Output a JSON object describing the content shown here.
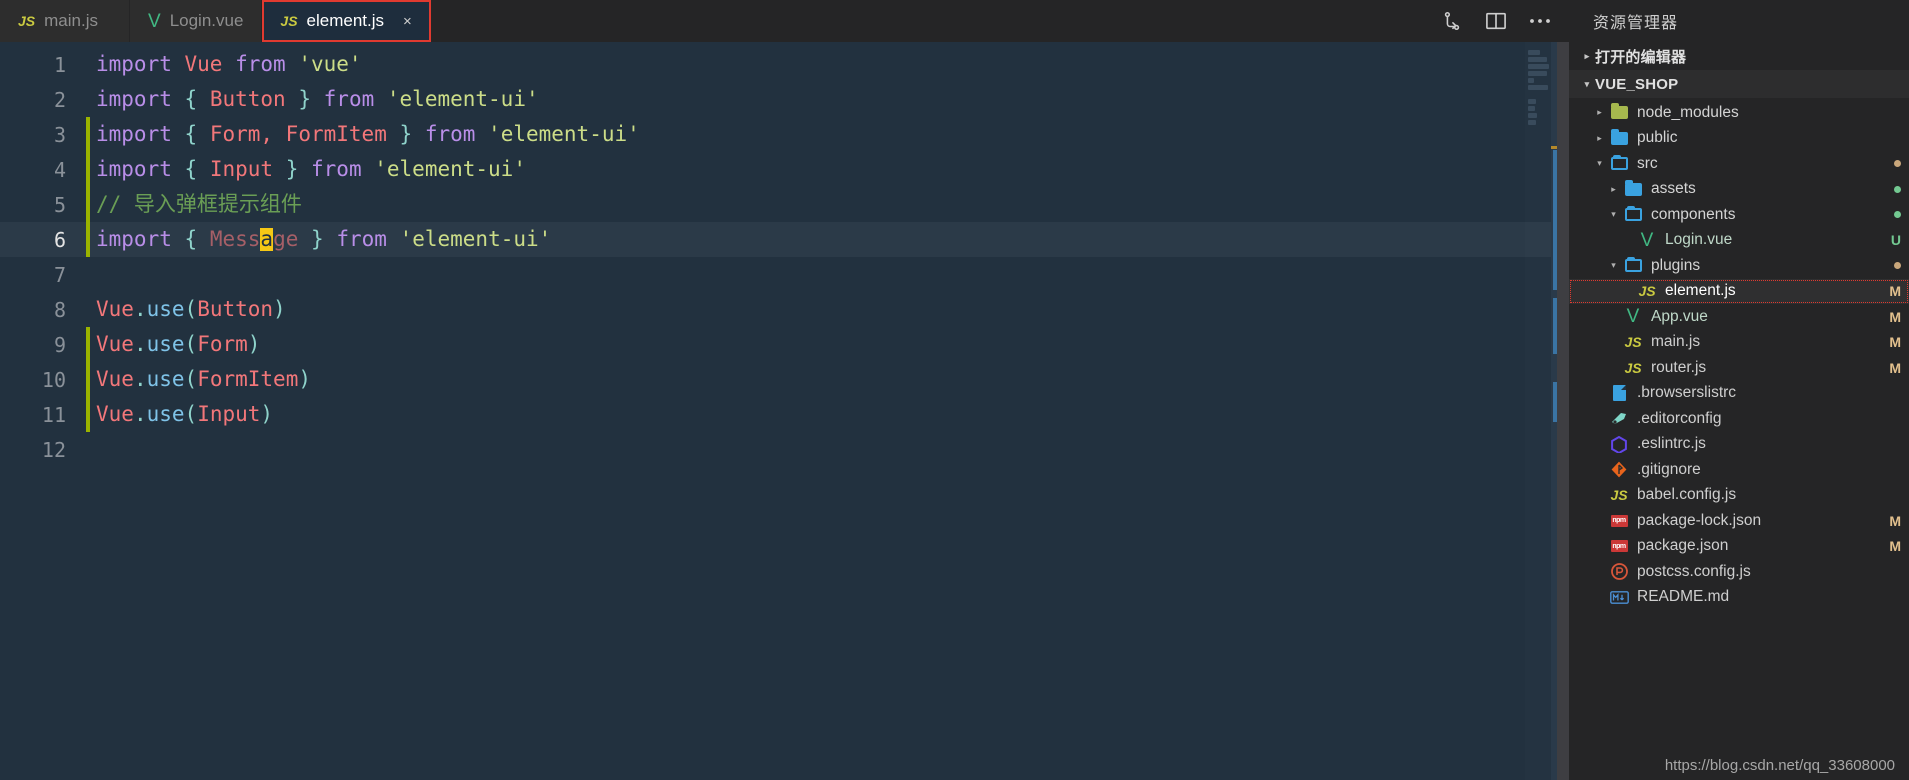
{
  "window": {
    "tabs": [
      {
        "icon": "js-file-icon",
        "label": "main.js",
        "active": false,
        "closable": false
      },
      {
        "icon": "vue-file-icon",
        "label": "Login.vue",
        "active": false,
        "closable": false
      },
      {
        "icon": "js-file-icon",
        "label": "element.js",
        "active": true,
        "closable": true,
        "close_label": "×",
        "highlighted": true
      }
    ],
    "actions": [
      {
        "name": "split-source-control-icon",
        "title": "Source Control"
      },
      {
        "name": "split-editor-icon",
        "title": "Split Editor"
      },
      {
        "name": "more-actions-icon",
        "title": "More Actions...",
        "glyph": "•••"
      }
    ],
    "sidebar_title": "资源管理器"
  },
  "editor": {
    "language": "javascript",
    "cursor_char": "a",
    "current_line": 6,
    "lines": [
      {
        "n": 1,
        "git": false,
        "current": false,
        "tokens": [
          {
            "t": "import",
            "c": "kw"
          },
          {
            "t": " ",
            "c": ""
          },
          {
            "t": "Vue",
            "c": "cls"
          },
          {
            "t": " ",
            "c": ""
          },
          {
            "t": "from",
            "c": "kw"
          },
          {
            "t": " ",
            "c": ""
          },
          {
            "t": "'vue'",
            "c": "str"
          }
        ]
      },
      {
        "n": 2,
        "git": false,
        "current": false,
        "tokens": [
          {
            "t": "import",
            "c": "kw"
          },
          {
            "t": " ",
            "c": ""
          },
          {
            "t": "{",
            "c": "pun"
          },
          {
            "t": " ",
            "c": ""
          },
          {
            "t": "Button",
            "c": "cls"
          },
          {
            "t": " ",
            "c": ""
          },
          {
            "t": "}",
            "c": "pun"
          },
          {
            "t": " ",
            "c": ""
          },
          {
            "t": "from",
            "c": "kw"
          },
          {
            "t": " ",
            "c": ""
          },
          {
            "t": "'element-ui'",
            "c": "str"
          }
        ]
      },
      {
        "n": 3,
        "git": true,
        "current": false,
        "tokens": [
          {
            "t": "import",
            "c": "kw"
          },
          {
            "t": " ",
            "c": ""
          },
          {
            "t": "{",
            "c": "pun"
          },
          {
            "t": " ",
            "c": ""
          },
          {
            "t": "Form, FormItem",
            "c": "cls"
          },
          {
            "t": " ",
            "c": ""
          },
          {
            "t": "}",
            "c": "pun"
          },
          {
            "t": " ",
            "c": ""
          },
          {
            "t": "from",
            "c": "kw"
          },
          {
            "t": " ",
            "c": ""
          },
          {
            "t": "'element-ui'",
            "c": "str"
          }
        ]
      },
      {
        "n": 4,
        "git": true,
        "current": false,
        "tokens": [
          {
            "t": "import",
            "c": "kw"
          },
          {
            "t": " ",
            "c": ""
          },
          {
            "t": "{",
            "c": "pun"
          },
          {
            "t": " ",
            "c": ""
          },
          {
            "t": "Input",
            "c": "cls"
          },
          {
            "t": " ",
            "c": ""
          },
          {
            "t": "}",
            "c": "pun"
          },
          {
            "t": " ",
            "c": ""
          },
          {
            "t": "from",
            "c": "kw"
          },
          {
            "t": " ",
            "c": ""
          },
          {
            "t": "'element-ui'",
            "c": "str"
          }
        ]
      },
      {
        "n": 5,
        "git": true,
        "current": false,
        "tokens": [
          {
            "t": "// 导入弹框提示组件",
            "c": "cm"
          }
        ]
      },
      {
        "n": 6,
        "git": true,
        "current": true,
        "tokens": [
          {
            "t": "import",
            "c": "kw"
          },
          {
            "t": " ",
            "c": ""
          },
          {
            "t": "{",
            "c": "pun"
          },
          {
            "t": " ",
            "c": ""
          },
          {
            "t": "Mess",
            "c": "dim"
          },
          {
            "t": "a",
            "c": "cursor"
          },
          {
            "t": "ge",
            "c": "dim"
          },
          {
            "t": " ",
            "c": ""
          },
          {
            "t": "}",
            "c": "pun"
          },
          {
            "t": " ",
            "c": ""
          },
          {
            "t": "from",
            "c": "kw"
          },
          {
            "t": " ",
            "c": ""
          },
          {
            "t": "'element-ui'",
            "c": "str"
          }
        ]
      },
      {
        "n": 7,
        "git": false,
        "current": false,
        "tokens": []
      },
      {
        "n": 8,
        "git": false,
        "current": false,
        "tokens": [
          {
            "t": "Vue",
            "c": "cls"
          },
          {
            "t": ".",
            "c": "pun"
          },
          {
            "t": "use",
            "c": "fn"
          },
          {
            "t": "(",
            "c": "pun"
          },
          {
            "t": "Button",
            "c": "cls"
          },
          {
            "t": ")",
            "c": "pun"
          }
        ]
      },
      {
        "n": 9,
        "git": true,
        "current": false,
        "tokens": [
          {
            "t": "Vue",
            "c": "cls"
          },
          {
            "t": ".",
            "c": "pun"
          },
          {
            "t": "use",
            "c": "fn"
          },
          {
            "t": "(",
            "c": "pun"
          },
          {
            "t": "Form",
            "c": "cls"
          },
          {
            "t": ")",
            "c": "pun"
          }
        ]
      },
      {
        "n": 10,
        "git": true,
        "current": false,
        "tokens": [
          {
            "t": "Vue",
            "c": "cls"
          },
          {
            "t": ".",
            "c": "pun"
          },
          {
            "t": "use",
            "c": "fn"
          },
          {
            "t": "(",
            "c": "pun"
          },
          {
            "t": "FormItem",
            "c": "cls"
          },
          {
            "t": ")",
            "c": "pun"
          }
        ]
      },
      {
        "n": 11,
        "git": true,
        "current": false,
        "tokens": [
          {
            "t": "Vue",
            "c": "cls"
          },
          {
            "t": ".",
            "c": "pun"
          },
          {
            "t": "use",
            "c": "fn"
          },
          {
            "t": "(",
            "c": "pun"
          },
          {
            "t": "Input",
            "c": "cls"
          },
          {
            "t": ")",
            "c": "pun"
          }
        ]
      },
      {
        "n": 12,
        "git": false,
        "current": false,
        "tokens": []
      }
    ]
  },
  "explorer": {
    "open_editors_label": "打开的编辑器",
    "project_label": "VUE_SHOP",
    "items": [
      {
        "label": "node_modules",
        "type": "folder",
        "indent": 1,
        "twisty": "collapsed",
        "icon": "folder-node-modules-icon",
        "color": "#a6b84e",
        "badge": "",
        "dot": ""
      },
      {
        "label": "public",
        "type": "folder",
        "indent": 1,
        "twisty": "collapsed",
        "icon": "folder-icon",
        "color": "#3aa2e0",
        "badge": "",
        "dot": ""
      },
      {
        "label": "src",
        "type": "folder",
        "indent": 1,
        "twisty": "expanded",
        "icon": "folder-open-icon",
        "color": "#3aa2e0",
        "badge": "",
        "dot": "#c9a77b"
      },
      {
        "label": "assets",
        "type": "folder",
        "indent": 2,
        "twisty": "collapsed",
        "icon": "folder-icon",
        "color": "#3aa2e0",
        "badge": "",
        "dot": "#73c991"
      },
      {
        "label": "components",
        "type": "folder",
        "indent": 2,
        "twisty": "expanded",
        "icon": "folder-open-icon",
        "color": "#3aa2e0",
        "badge": "",
        "dot": "#73c991"
      },
      {
        "label": "Login.vue",
        "type": "file",
        "indent": 3,
        "twisty": "none",
        "icon": "vue-file-icon",
        "color": "#41b883",
        "badge": "U",
        "dot": ""
      },
      {
        "label": "plugins",
        "type": "folder",
        "indent": 2,
        "twisty": "expanded",
        "icon": "folder-open-icon",
        "color": "#3aa2e0",
        "badge": "",
        "dot": "#c9a77b"
      },
      {
        "label": "element.js",
        "type": "file",
        "indent": 3,
        "twisty": "none",
        "icon": "js-file-icon",
        "color": "#cbcb41",
        "badge": "M",
        "dot": "",
        "selected": true
      },
      {
        "label": "App.vue",
        "type": "file",
        "indent": 2,
        "twisty": "none",
        "icon": "vue-file-icon",
        "color": "#41b883",
        "badge": "M",
        "dot": ""
      },
      {
        "label": "main.js",
        "type": "file",
        "indent": 2,
        "twisty": "none",
        "icon": "js-file-icon",
        "color": "#cbcb41",
        "badge": "M",
        "dot": ""
      },
      {
        "label": "router.js",
        "type": "file",
        "indent": 2,
        "twisty": "none",
        "icon": "js-file-icon",
        "color": "#cbcb41",
        "badge": "M",
        "dot": ""
      },
      {
        "label": ".browserslistrc",
        "type": "file",
        "indent": 1,
        "twisty": "none",
        "icon": "config-doc-icon",
        "color": "#3aa2e0",
        "badge": "",
        "dot": ""
      },
      {
        "label": ".editorconfig",
        "type": "file",
        "indent": 1,
        "twisty": "none",
        "icon": "editorconfig-icon",
        "color": "#7fd6c8",
        "badge": "",
        "dot": ""
      },
      {
        "label": ".eslintrc.js",
        "type": "file",
        "indent": 1,
        "twisty": "none",
        "icon": "eslint-icon",
        "color": "#6246ea",
        "badge": "",
        "dot": ""
      },
      {
        "label": ".gitignore",
        "type": "file",
        "indent": 1,
        "twisty": "none",
        "icon": "git-icon",
        "color": "#e8641c",
        "badge": "",
        "dot": ""
      },
      {
        "label": "babel.config.js",
        "type": "file",
        "indent": 1,
        "twisty": "none",
        "icon": "js-file-icon",
        "color": "#cbcb41",
        "badge": "",
        "dot": ""
      },
      {
        "label": "package-lock.json",
        "type": "file",
        "indent": 1,
        "twisty": "none",
        "icon": "npm-icon",
        "color": "#cb3837",
        "badge": "M",
        "dot": ""
      },
      {
        "label": "package.json",
        "type": "file",
        "indent": 1,
        "twisty": "none",
        "icon": "npm-icon",
        "color": "#cb3837",
        "badge": "M",
        "dot": ""
      },
      {
        "label": "postcss.config.js",
        "type": "file",
        "indent": 1,
        "twisty": "none",
        "icon": "postcss-icon",
        "color": "#d8563a",
        "badge": "",
        "dot": ""
      },
      {
        "label": "README.md",
        "type": "file",
        "indent": 1,
        "twisty": "none",
        "icon": "markdown-icon",
        "color": "#4b8fd4",
        "badge": "",
        "dot": ""
      }
    ]
  },
  "watermark": "https://blog.csdn.net/qq_33608000",
  "colors": {
    "editor_bg": "#22313f",
    "panel_bg": "#252526",
    "accent_red": "#e03a30",
    "git_modified": "#e2c08d",
    "git_untracked": "#73c991"
  }
}
